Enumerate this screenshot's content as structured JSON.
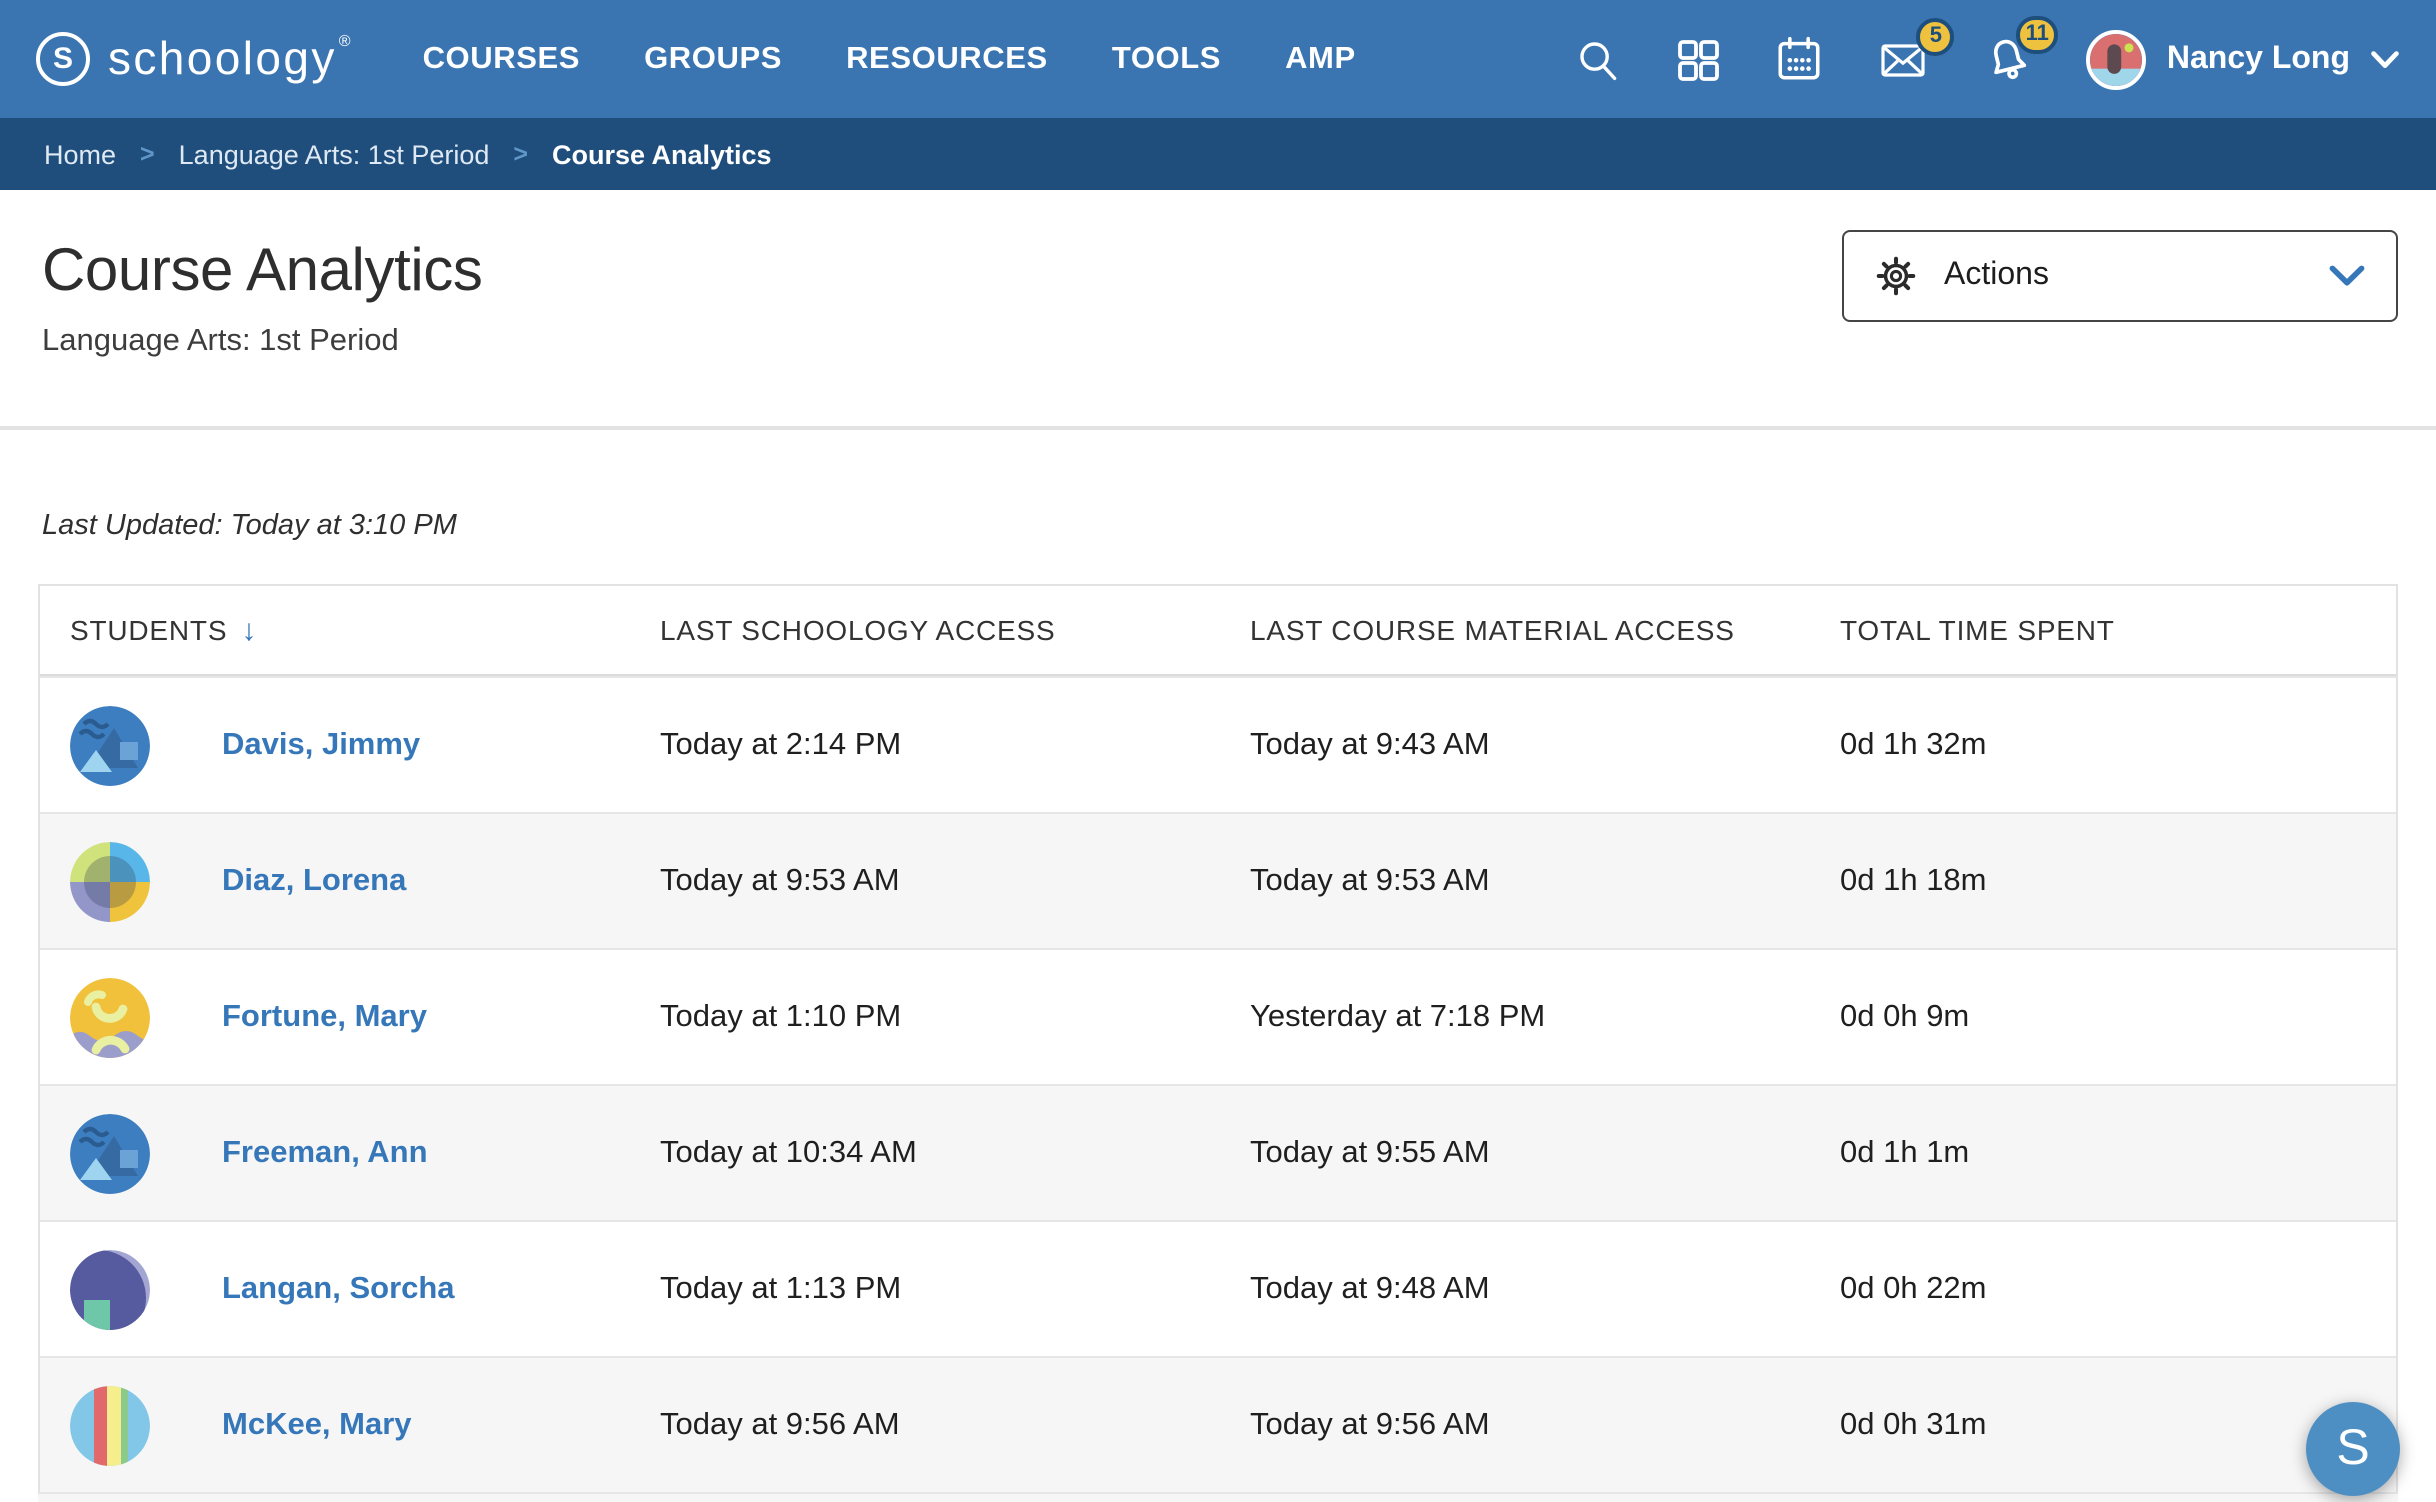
{
  "brand": {
    "name": "schoology",
    "mark": "®",
    "initial": "S"
  },
  "nav": {
    "links": [
      "COURSES",
      "GROUPS",
      "RESOURCES",
      "TOOLS",
      "AMP"
    ],
    "badges": {
      "messages": "5",
      "notifications": "11"
    },
    "user": {
      "name": "Nancy Long"
    }
  },
  "breadcrumb": {
    "separator": ">",
    "items": [
      "Home",
      "Language Arts: 1st Period",
      "Course Analytics"
    ]
  },
  "page": {
    "title": "Course Analytics",
    "subtitle": "Language Arts: 1st Period",
    "actions_label": "Actions",
    "last_updated": "Last Updated: Today at 3:10 PM"
  },
  "table": {
    "columns": [
      "STUDENTS",
      "LAST SCHOOLOGY ACCESS",
      "LAST COURSE MATERIAL ACCESS",
      "TOTAL TIME SPENT"
    ],
    "sort_indicator": "↓",
    "rows": [
      {
        "name": "Davis, Jimmy",
        "avatar": "blue-mountains-avatar",
        "last_schoology_access": "Today at 2:14 PM",
        "last_material_access": "Today at 9:43 AM",
        "total_time": "0d 1h 32m"
      },
      {
        "name": "Diaz, Lorena",
        "avatar": "quadrants-avatar",
        "last_schoology_access": "Today at 9:53 AM",
        "last_material_access": "Today at 9:53 AM",
        "total_time": "0d 1h 18m"
      },
      {
        "name": "Fortune, Mary",
        "avatar": "yellow-waves-avatar",
        "last_schoology_access": "Today at 1:10 PM",
        "last_material_access": "Yesterday at 7:18 PM",
        "total_time": "0d 0h 9m"
      },
      {
        "name": "Freeman, Ann",
        "avatar": "blue-mountains-avatar",
        "last_schoology_access": "Today at 10:34 AM",
        "last_material_access": "Today at 9:55 AM",
        "total_time": "0d 1h 1m"
      },
      {
        "name": "Langan, Sorcha",
        "avatar": "purple-crescent-avatar",
        "last_schoology_access": "Today at 1:13 PM",
        "last_material_access": "Today at 9:48 AM",
        "total_time": "0d 0h 22m"
      },
      {
        "name": "McKee, Mary",
        "avatar": "stripes-avatar",
        "last_schoology_access": "Today at 9:56 AM",
        "last_material_access": "Today at 9:56 AM",
        "total_time": "0d 0h 31m"
      }
    ]
  },
  "floating_button": {
    "label": "S"
  },
  "colors": {
    "nav_blue": "#3a75b2",
    "breadcrumb_blue": "#1f4e7c",
    "link_blue": "#3577b8",
    "badge_yellow": "#eec13e",
    "row_alt_gray": "#f6f6f7",
    "border_gray": "#e2e2e2"
  }
}
